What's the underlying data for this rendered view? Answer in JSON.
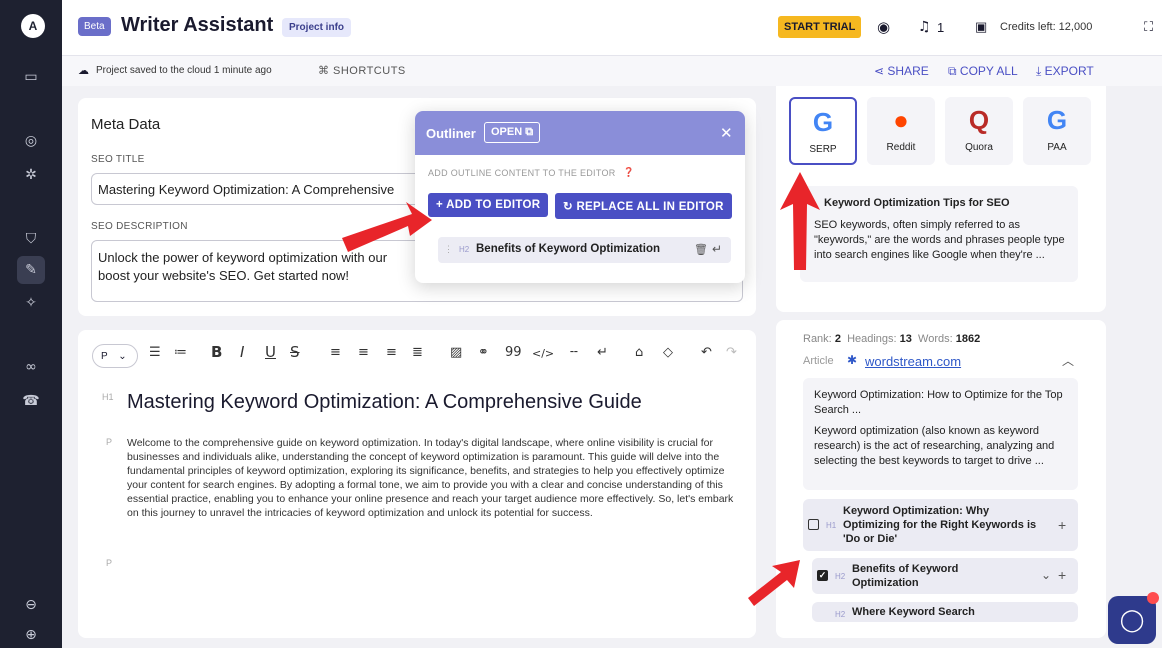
{
  "header": {
    "beta": "Beta",
    "title": "Writer Assistant",
    "project_info": "Project info",
    "start_trial": "START TRIAL",
    "notifications_count": "1",
    "credits": "Credits left: 12,000"
  },
  "subbar": {
    "saved": "Project saved to the cloud 1 minute ago",
    "shortcuts": "SHORTCUTS",
    "share": "SHARE",
    "copy_all": "COPY ALL",
    "export": "EXPORT"
  },
  "meta": {
    "heading": "Meta Data",
    "seo_title_label": "SEO TITLE",
    "seo_title_value": "Mastering Keyword Optimization: A Comprehensive",
    "seo_desc_label": "SEO DESCRIPTION",
    "seo_desc_value": "Unlock the power of keyword optimization with our boost your website's SEO. Get started now!"
  },
  "outliner": {
    "title": "Outliner",
    "open": "OPEN",
    "hint": "ADD OUTLINE CONTENT TO THE EDITOR",
    "add": "ADD TO EDITOR",
    "replace": "REPLACE ALL IN EDITOR",
    "item_tag": "H2",
    "item_text": "Benefits of Keyword Optimization"
  },
  "editor": {
    "block_type": "P",
    "h1_tag": "H1",
    "h1": "Mastering Keyword Optimization: A Comprehensive Guide",
    "p_tag": "P",
    "paragraph": "Welcome to the comprehensive guide on keyword optimization. In today's digital landscape, where online visibility is crucial for businesses and individuals alike, understanding the concept of keyword optimization is paramount. This guide will delve into the fundamental principles of keyword optimization, exploring its significance, benefits, and strategies to help you effectively optimize your content for search engines. By adopting a formal tone, we aim to provide you with a clear and concise understanding of this essential practice, enabling you to enhance your online presence and reach your target audience more effectively. So, let's embark on this journey to unravel the intricacies of keyword optimization and unlock its potential for success.",
    "empty_tag": "P"
  },
  "sources": [
    {
      "name": "SERP",
      "glyph": "G",
      "color": "#4285f4"
    },
    {
      "name": "Reddit",
      "glyph": "●",
      "color": "#ff4500"
    },
    {
      "name": "Quora",
      "glyph": "Q",
      "color": "#b92b27"
    },
    {
      "name": "PAA",
      "glyph": "G",
      "color": "#4285f4"
    }
  ],
  "tip": {
    "title": "Keyword Optimization Tips for SEO",
    "body": "SEO keywords, often simply referred to as \"keywords,\" are the words and phrases people type into search engines like Google when they're ..."
  },
  "result": {
    "rank_label": "Rank:",
    "rank": "2",
    "headings_label": "Headings:",
    "headings": "13",
    "words_label": "Words:",
    "words": "1862",
    "type": "Article",
    "domain": "wordstream.com",
    "title": "Keyword Optimization: How to Optimize for the Top Search ...",
    "desc": "Keyword optimization (also known as keyword research) is the act of researching, analyzing and selecting the best keywords to target to drive ...",
    "items": [
      {
        "tag": "H1",
        "text": "Keyword Optimization: Why Optimizing for the Right Keywords is 'Do or Die'"
      },
      {
        "tag": "H2",
        "text": "Benefits of Keyword Optimization"
      },
      {
        "tag": "H2",
        "text": "Where Keyword Search"
      }
    ]
  }
}
